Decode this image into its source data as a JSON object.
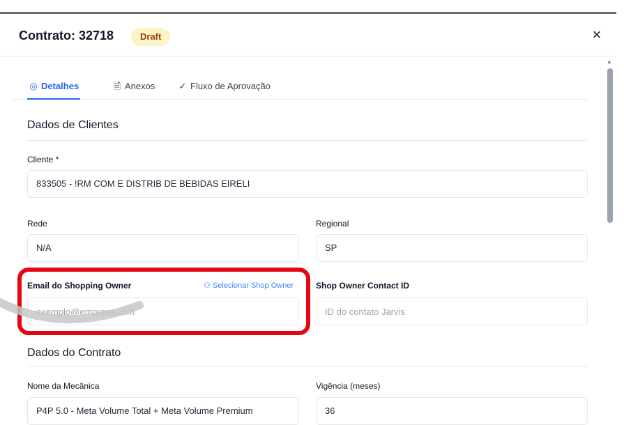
{
  "modal": {
    "title": "Contrato: 32718",
    "status": "Draft",
    "close": "×"
  },
  "tabs": [
    {
      "label": "Detalhes",
      "icon": "target-icon",
      "glyph": "◎",
      "active": true
    },
    {
      "label": "Anexos",
      "icon": "document-icon",
      "glyph": "🗎",
      "active": false
    },
    {
      "label": "Fluxo de Aprovação",
      "icon": "check-circle-icon",
      "glyph": "✓",
      "active": false
    }
  ],
  "clientes": {
    "title": "Dados de Clientes",
    "cliente_label": "Cliente *",
    "cliente_value": "833505 - !RM COM E DISTRIB DE BEBIDAS EIRELI",
    "rede_label": "Rede",
    "rede_value": "N/A",
    "regional_label": "Regional",
    "regional_value": "SP",
    "email_label": "Email do Shopping Owner",
    "email_placeholder": "exemplo@empresa.com",
    "select_owner": "Selecionar Shop Owner",
    "contact_label": "Shop Owner Contact ID",
    "contact_placeholder": "ID do contato Jarvis"
  },
  "contrato": {
    "title": "Dados do Contrato",
    "mecanica_label": "Nome da Mecânica",
    "mecanica_value": "P4P 5.0 - Meta Volume Total  + Meta Volume Premium",
    "vigencia_label": "Vigência (meses)",
    "vigencia_value": "36"
  },
  "colors": {
    "accent": "#2563eb",
    "highlight": "#e30613",
    "badge_bg": "#fdf3c4"
  }
}
